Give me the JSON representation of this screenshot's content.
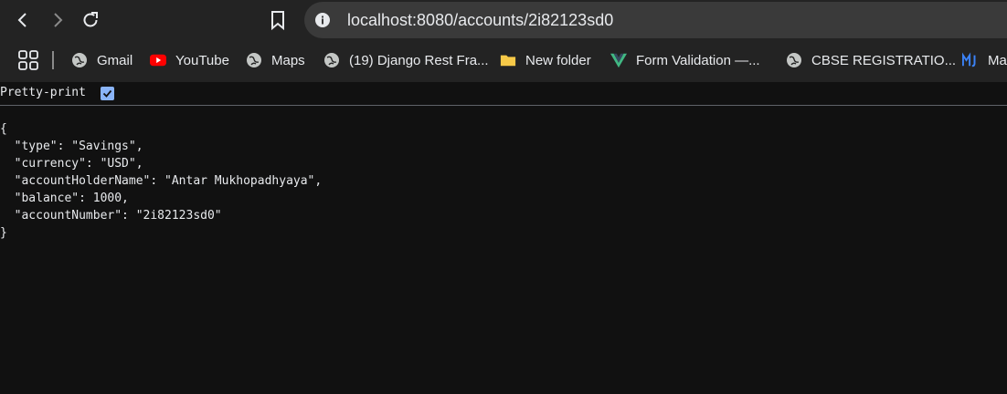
{
  "browser": {
    "url": "localhost:8080/accounts/2i82123sd0",
    "icons": {
      "back": "arrow-left-icon",
      "forward": "arrow-right-icon",
      "reload": "reload-icon",
      "bookmark": "bookmark-icon",
      "site_info": "info-icon"
    }
  },
  "bookmarks": [
    {
      "label": "Gmail",
      "icon": "globe-icon"
    },
    {
      "label": "YouTube",
      "icon": "youtube-icon"
    },
    {
      "label": "Maps",
      "icon": "globe-icon"
    },
    {
      "label": "(19) Django Rest Fra...",
      "icon": "globe-icon"
    },
    {
      "label": "New folder",
      "icon": "folder-icon"
    },
    {
      "label": "Form Validation —...",
      "icon": "vue-icon"
    },
    {
      "label": "CBSE REGISTRATIO...",
      "icon": "globe-icon"
    },
    {
      "label": "Ma",
      "icon": "mj-icon"
    }
  ],
  "viewer": {
    "pretty_print_label": "Pretty-print",
    "pretty_print_checked": true
  },
  "json": {
    "open": "{",
    "lines": [
      "  \"type\": \"Savings\",",
      "  \"currency\": \"USD\",",
      "  \"accountHolderName\": \"Antar Mukhopadhyaya\",",
      "  \"balance\": 1000,",
      "  \"accountNumber\": \"2i82123sd0\""
    ],
    "close": "}"
  },
  "colors": {
    "toolbar": "#232323",
    "omnibox": "#3a3a3a",
    "page": "#111111",
    "checkbox": "#8ab4f8",
    "youtube": "#ff0000",
    "folder": "#f7c948",
    "vue": "#41b883",
    "mj": "#3b82f6"
  }
}
